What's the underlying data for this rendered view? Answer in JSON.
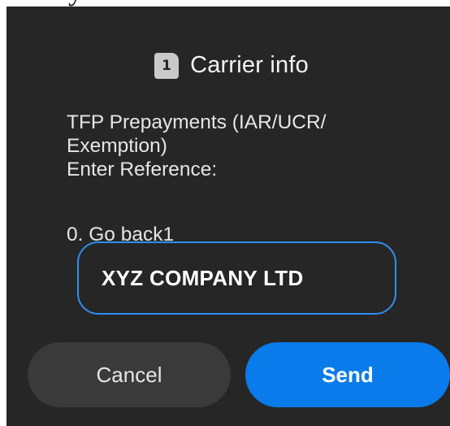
{
  "background_fragment": "y",
  "dialog": {
    "sim_badge": "1",
    "title": "Carrier info",
    "message_lines": [
      "TFP Prepayments (IAR/UCR/",
      "Exemption)",
      "Enter Reference:"
    ],
    "go_back": "0. Go back1",
    "input_value": "XYZ COMPANY LTD",
    "cancel_label": "Cancel",
    "send_label": "Send"
  },
  "colors": {
    "dialog_bg": "#262626",
    "accent": "#0a7bea",
    "input_border": "#2f8ff2",
    "cancel_bg": "#3a3a3a"
  }
}
